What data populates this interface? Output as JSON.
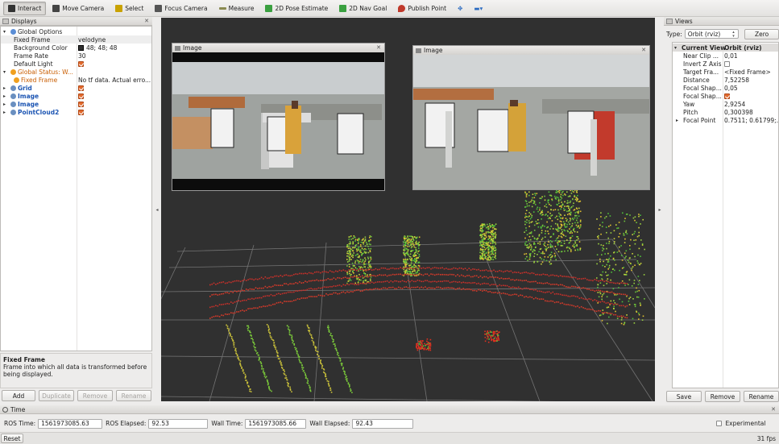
{
  "toolbar": {
    "tools": [
      {
        "label": "Interact",
        "icon": "interact-icon",
        "active": true
      },
      {
        "label": "Move Camera",
        "icon": "move-camera-icon"
      },
      {
        "label": "Select",
        "icon": "select-icon"
      },
      {
        "label": "Focus Camera",
        "icon": "focus-camera-icon"
      },
      {
        "label": "Measure",
        "icon": "measure-icon"
      },
      {
        "label": "2D Pose Estimate",
        "icon": "pose-estimate-icon"
      },
      {
        "label": "2D Nav Goal",
        "icon": "nav-goal-icon"
      },
      {
        "label": "Publish Point",
        "icon": "publish-point-icon"
      }
    ]
  },
  "displays": {
    "title": "Displays",
    "rows": [
      {
        "key": "Global Options",
        "value": "",
        "level": 0,
        "arrow": "▾",
        "icon": "global-options-icon"
      },
      {
        "key": "Fixed Frame",
        "value": "velodyne",
        "level": 1,
        "selected": true
      },
      {
        "key": "Background Color",
        "value": "48; 48; 48",
        "level": 1,
        "swatch": "#303030"
      },
      {
        "key": "Frame Rate",
        "value": "30",
        "level": 1
      },
      {
        "key": "Default Light",
        "value": "",
        "level": 1,
        "check": true
      },
      {
        "key": "Global Status: W...",
        "value": "",
        "level": 0,
        "arrow": "▾",
        "warn": true
      },
      {
        "key": "Fixed Frame",
        "value": "No tf data.  Actual erro...",
        "level": 1,
        "warn": true
      },
      {
        "key": "Grid",
        "value": "",
        "level": 0,
        "arrow": "▸",
        "blue": true,
        "check": true,
        "icon": "grid-icon"
      },
      {
        "key": "Image",
        "value": "",
        "level": 0,
        "arrow": "▸",
        "blue": true,
        "check": true,
        "icon": "image-display-icon"
      },
      {
        "key": "Image",
        "value": "",
        "level": 0,
        "arrow": "▸",
        "blue": true,
        "check": true,
        "icon": "image-display-icon"
      },
      {
        "key": "PointCloud2",
        "value": "",
        "level": 0,
        "arrow": "▸",
        "blue": true,
        "check": true,
        "icon": "pointcloud-icon"
      }
    ],
    "description_title": "Fixed Frame",
    "description_text": "Frame into which all data is transformed before being displayed.",
    "buttons": {
      "add": "Add",
      "duplicate": "Duplicate",
      "remove": "Remove",
      "rename": "Rename"
    }
  },
  "image_windows": [
    {
      "title": "Image"
    },
    {
      "title": "Image"
    }
  ],
  "views": {
    "title": "Views",
    "type_label": "Type:",
    "type_value": "Orbit (rviz)",
    "zero_label": "Zero",
    "header_key": "Current View",
    "header_value": "Orbit (rviz)",
    "rows": [
      {
        "key": "Near Clip ...",
        "value": "0,01"
      },
      {
        "key": "Invert Z Axis",
        "value": "",
        "checkbox": "off"
      },
      {
        "key": "Target Fra...",
        "value": "<Fixed Frame>"
      },
      {
        "key": "Distance",
        "value": "7,52258"
      },
      {
        "key": "Focal Shap...",
        "value": "0,05"
      },
      {
        "key": "Focal Shap...",
        "value": "",
        "checkbox": "on"
      },
      {
        "key": "Yaw",
        "value": "2,9254"
      },
      {
        "key": "Pitch",
        "value": "0,300398"
      },
      {
        "key": "Focal Point",
        "value": "0.7511; 0.61799;...",
        "arrow": "▸"
      }
    ],
    "buttons": {
      "save": "Save",
      "remove": "Remove",
      "rename": "Rename"
    }
  },
  "time": {
    "title": "Time",
    "ros_time_label": "ROS Time:",
    "ros_time": "1561973085.63",
    "ros_elapsed_label": "ROS Elapsed:",
    "ros_elapsed": "92.53",
    "wall_time_label": "Wall Time:",
    "wall_time": "1561973085.66",
    "wall_elapsed_label": "Wall Elapsed:",
    "wall_elapsed": "92.43",
    "experimental_label": "Experimental"
  },
  "status": {
    "reset_label": "Reset",
    "fps": "31 fps"
  },
  "colors": {
    "viewport_bg": "#303030",
    "checkbox_on": "#e26a2e",
    "display_link": "#1c55b3"
  }
}
